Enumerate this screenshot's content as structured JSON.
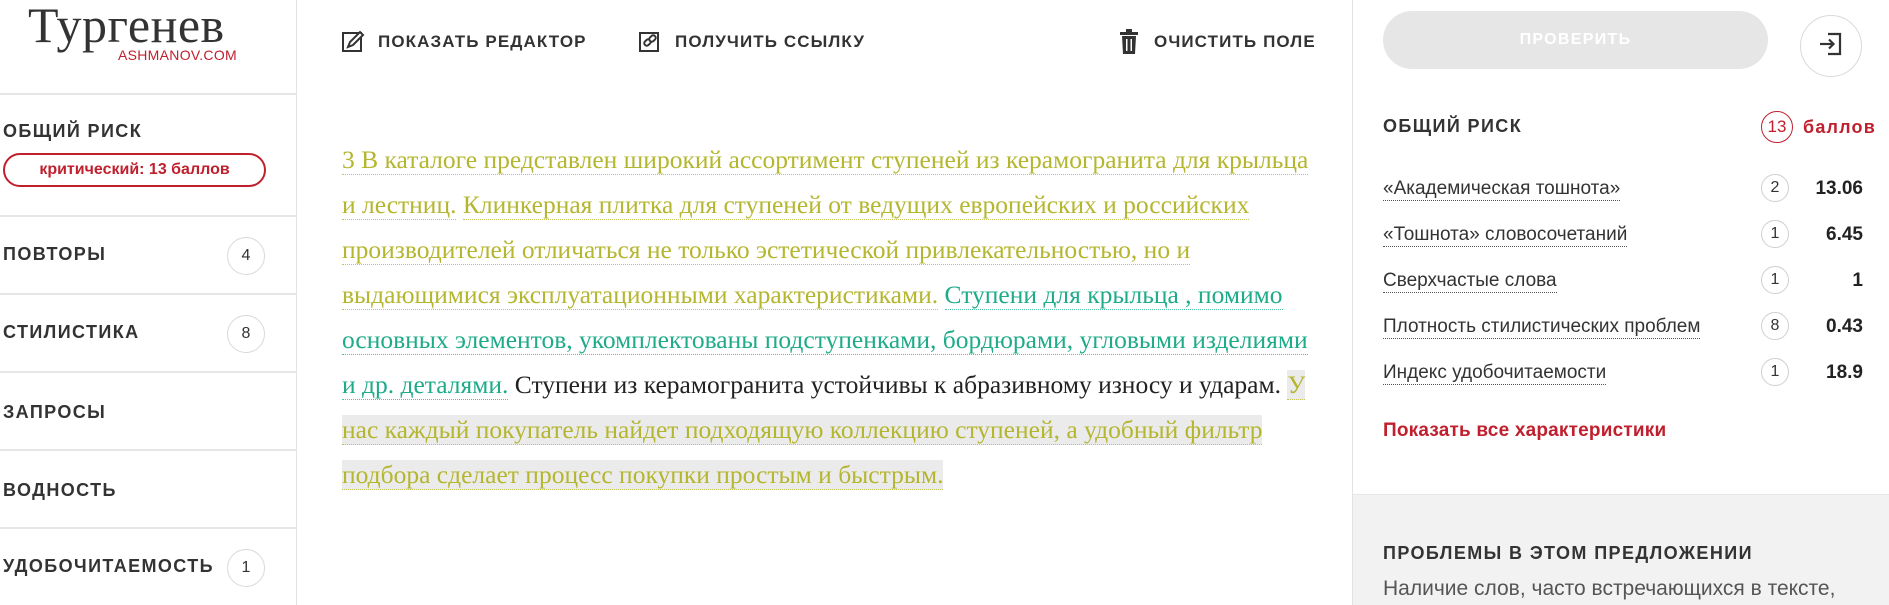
{
  "logo": {
    "main": "Тургенев",
    "sub": "ASHMANOV.COM"
  },
  "sidebar": {
    "overall_risk": {
      "title": "ОБЩИЙ РИСК",
      "badge": "критический: 13 баллов"
    },
    "items": [
      {
        "label": "ПОВТОРЫ",
        "count": "4"
      },
      {
        "label": "СТИЛИСТИКА",
        "count": "8"
      },
      {
        "label": "ЗАПРОСЫ",
        "count": ""
      },
      {
        "label": "ВОДНОСТЬ",
        "count": ""
      },
      {
        "label": "УДОБОЧИТАЕМОСТЬ",
        "count": "1"
      }
    ]
  },
  "toolbar": {
    "show_editor": "ПОКАЗАТЬ РЕДАКТОР",
    "get_link": "ПОЛУЧИТЬ ССЫЛКУ",
    "clear_field": "ОЧИСТИТЬ ПОЛЕ"
  },
  "text": {
    "segments": [
      {
        "style": "yellow",
        "text": "3 В каталоге представлен широкий ассортимент ступеней из керамогранита для крыльца и лестниц."
      },
      {
        "style": "plain",
        "text": " "
      },
      {
        "style": "yellow",
        "text": "Клинкерная плитка для ступеней от ведущих европейских и российских производителей отличаться не только эстетической привлекательностью, но и выдающимися эксплуатационными характеристиками."
      },
      {
        "style": "plain",
        "text": " "
      },
      {
        "style": "green",
        "text": "Ступени для крыльца , помимо основных элементов, укомплектованы подступенками, бордюрами, угловыми изделиями и др. деталями."
      },
      {
        "style": "plain",
        "text": " Ступени из керамогранита устойчивы к абразивному износу и ударам. "
      },
      {
        "style": "gray",
        "text": "У нас каждый покупатель найдет подходящую коллекцию ступеней, а удобный фильтр подбора сделает процесс покупки простым и быстрым."
      }
    ]
  },
  "right_panel": {
    "check_button": "ПРОВЕРИТЬ",
    "overall_risk": {
      "title": "ОБЩИЙ РИСК",
      "score": "13",
      "unit": "баллов"
    },
    "metrics": [
      {
        "name": "«Академическая тошнота»",
        "count": "2",
        "value": "13.06"
      },
      {
        "name": "«Тошнота» словосочетаний",
        "count": "1",
        "value": "6.45"
      },
      {
        "name": "Сверхчастые слова",
        "count": "1",
        "value": "1"
      },
      {
        "name": "Плотность стилистических проблем",
        "count": "8",
        "value": "0.43"
      },
      {
        "name": "Индекс удобочитаемости",
        "count": "1",
        "value": "18.9"
      }
    ],
    "show_all": "Показать все характеристики",
    "problems": {
      "title": "ПРОБЛЕМЫ В ЭТОМ ПРЕДЛОЖЕНИИ",
      "text": "Наличие слов, часто встречающихся в тексте,"
    }
  },
  "colors": {
    "accent_red": "#c0202e",
    "highlight_yellow": "#b5b62f",
    "highlight_green": "#1fab8a",
    "button_disabled": "#e6e6e6"
  }
}
